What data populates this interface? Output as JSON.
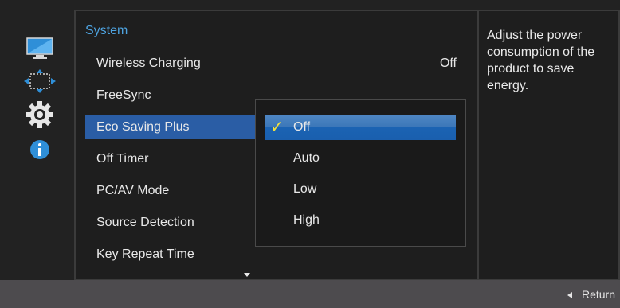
{
  "menu": {
    "title": "System",
    "items": [
      {
        "label": "Wireless Charging",
        "value": "Off"
      },
      {
        "label": "FreeSync",
        "value": ""
      },
      {
        "label": "Eco Saving Plus",
        "value": ""
      },
      {
        "label": "Off Timer",
        "value": ""
      },
      {
        "label": "PC/AV Mode",
        "value": ""
      },
      {
        "label": "Source Detection",
        "value": ""
      },
      {
        "label": "Key Repeat Time",
        "value": ""
      }
    ],
    "selected_index": 2
  },
  "dropdown": {
    "options": [
      "Off",
      "Auto",
      "Low",
      "High"
    ],
    "selected": "Off",
    "check_mark": "✓"
  },
  "help": {
    "text": "Adjust the power consumption of the product to save energy."
  },
  "footer": {
    "return_label": "Return"
  },
  "icons": [
    "picture-icon",
    "onscreen-display-icon",
    "system-gear-icon",
    "information-icon"
  ],
  "colors": {
    "accent_title": "#4ea3e0",
    "selected_item": "#2a5da5",
    "check": "#f5e23a"
  }
}
